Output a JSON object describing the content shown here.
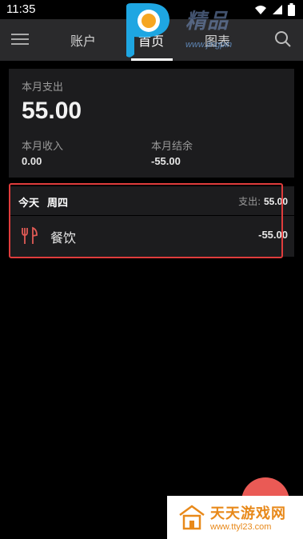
{
  "status_bar": {
    "time": "11:35",
    "icons": [
      "wifi-icon",
      "signal-icon",
      "battery-icon"
    ]
  },
  "nav": {
    "tabs": [
      {
        "label": "账户"
      },
      {
        "label": "首页"
      },
      {
        "label": "图表"
      }
    ],
    "active_tab": "首页",
    "icons": [
      "menu-icon",
      "search-icon"
    ]
  },
  "watermark_top": {
    "text": "精品",
    "url": "www.jingpin"
  },
  "summary": {
    "expense_label": "本月支出",
    "expense_value": "55.00",
    "income_label": "本月收入",
    "income_value": "0.00",
    "balance_label": "本月结余",
    "balance_value": "-55.00"
  },
  "day": {
    "today": "今天",
    "weekday": "周四",
    "expense_label": "支出:",
    "expense_value": "55.00",
    "entries": [
      {
        "icon": "fork-knife-icon",
        "category": "餐饮",
        "amount": "-55.00"
      }
    ]
  },
  "watermark_bottom": {
    "name": "天天游戏网",
    "url": "www.ttyl23.com"
  },
  "colors": {
    "background": "#000000",
    "card": "#1c1c1e",
    "navbar": "#2a2a2c",
    "accent": "#ea5a55",
    "highlight": "#e03c3c",
    "watermark_orange": "#e8891a"
  }
}
